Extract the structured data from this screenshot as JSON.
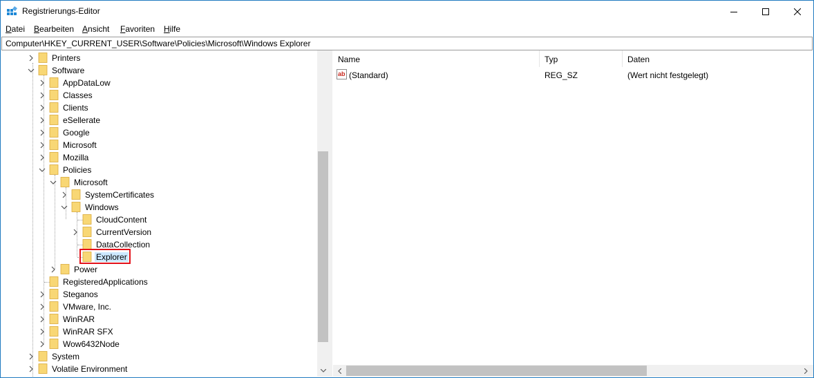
{
  "window": {
    "title": "Registrierungs-Editor",
    "controls": [
      "minimize",
      "maximize",
      "close"
    ]
  },
  "menu": [
    "Datei",
    "Bearbeiten",
    "Ansicht",
    "Favoriten",
    "Hilfe"
  ],
  "address": "Computer\\HKEY_CURRENT_USER\\Software\\Policies\\Microsoft\\Windows Explorer",
  "tree": {
    "items": [
      {
        "label": "Printers",
        "depth": 0,
        "state": "collapsed"
      },
      {
        "label": "Software",
        "depth": 0,
        "state": "expanded"
      },
      {
        "label": "AppDataLow",
        "depth": 1,
        "state": "collapsed"
      },
      {
        "label": "Classes",
        "depth": 1,
        "state": "collapsed"
      },
      {
        "label": "Clients",
        "depth": 1,
        "state": "collapsed"
      },
      {
        "label": "eSellerate",
        "depth": 1,
        "state": "collapsed"
      },
      {
        "label": "Google",
        "depth": 1,
        "state": "collapsed"
      },
      {
        "label": "Microsoft",
        "depth": 1,
        "state": "collapsed"
      },
      {
        "label": "Mozilla",
        "depth": 1,
        "state": "collapsed"
      },
      {
        "label": "Policies",
        "depth": 1,
        "state": "expanded"
      },
      {
        "label": "Microsoft",
        "depth": 2,
        "state": "expanded"
      },
      {
        "label": "SystemCertificates",
        "depth": 3,
        "state": "collapsed"
      },
      {
        "label": "Windows",
        "depth": 3,
        "state": "expanded"
      },
      {
        "label": "CloudContent",
        "depth": 4,
        "state": "leaf"
      },
      {
        "label": "CurrentVersion",
        "depth": 4,
        "state": "collapsed"
      },
      {
        "label": "DataCollection",
        "depth": 4,
        "state": "leaf"
      },
      {
        "label": "Explorer",
        "depth": 4,
        "state": "leaf",
        "selected": true
      },
      {
        "label": "Power",
        "depth": 2,
        "state": "collapsed"
      },
      {
        "label": "RegisteredApplications",
        "depth": 1,
        "state": "leaf"
      },
      {
        "label": "Steganos",
        "depth": 1,
        "state": "collapsed"
      },
      {
        "label": "VMware, Inc.",
        "depth": 1,
        "state": "collapsed"
      },
      {
        "label": "WinRAR",
        "depth": 1,
        "state": "collapsed"
      },
      {
        "label": "WinRAR SFX",
        "depth": 1,
        "state": "collapsed"
      },
      {
        "label": "Wow6432Node",
        "depth": 1,
        "state": "collapsed"
      },
      {
        "label": "System",
        "depth": 0,
        "state": "collapsed"
      },
      {
        "label": "Volatile Environment",
        "depth": 0,
        "state": "collapsed"
      }
    ]
  },
  "list": {
    "columns": [
      "Name",
      "Typ",
      "Daten"
    ],
    "rows": [
      {
        "name": "(Standard)",
        "type": "REG_SZ",
        "data": "(Wert nicht festgelegt)",
        "icon": "string-value-icon"
      }
    ]
  },
  "colors": {
    "folder": "#f8d775",
    "selection": "#cce8ff",
    "highlight_box": "#e3111a",
    "window_border": "#1f7ac0"
  }
}
